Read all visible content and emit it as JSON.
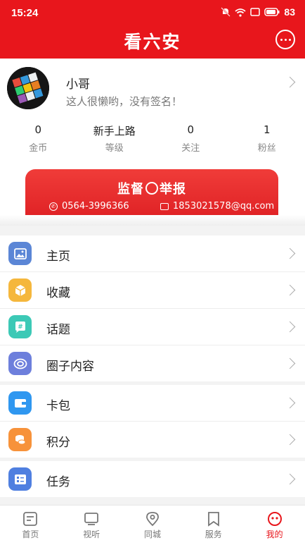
{
  "status_bar": {
    "time": "15:24",
    "battery": "83"
  },
  "header": {
    "title": "看六安"
  },
  "profile": {
    "username": "小哥",
    "signature": "这人很懒哟，没有签名！",
    "stats": [
      {
        "value": "0",
        "label": "金币"
      },
      {
        "value": "新手上路",
        "label": "等级"
      },
      {
        "value": "0",
        "label": "关注"
      },
      {
        "value": "1",
        "label": "粉丝"
      }
    ]
  },
  "report": {
    "title_left": "监督",
    "title_right": "举报",
    "phone": "0564-3996366",
    "email": "1853021578@qq.com"
  },
  "menu_groups": [
    {
      "items": [
        {
          "label": "主页",
          "icon": "image-icon",
          "color": "#5b86d6"
        },
        {
          "label": "收藏",
          "icon": "box-icon",
          "color": "#f5b73c"
        },
        {
          "label": "话题",
          "icon": "topic-icon",
          "color": "#3cc9b6"
        },
        {
          "label": "圈子内容",
          "icon": "circle-icon",
          "color": "#6d7fdc"
        }
      ]
    },
    {
      "items": [
        {
          "label": "卡包",
          "icon": "card-icon",
          "color": "#2f97f0"
        },
        {
          "label": "积分",
          "icon": "coins-icon",
          "color": "#f7923a"
        }
      ]
    },
    {
      "items": [
        {
          "label": "任务",
          "icon": "task-icon",
          "color": "#4f7fe0"
        }
      ]
    }
  ],
  "tabbar": {
    "active_color": "#e8161c",
    "items": [
      {
        "label": "首页",
        "icon": "home-doc-icon"
      },
      {
        "label": "视听",
        "icon": "tv-icon"
      },
      {
        "label": "同城",
        "icon": "location-icon"
      },
      {
        "label": "服务",
        "icon": "bookmark-icon"
      },
      {
        "label": "我的",
        "icon": "user-face-icon",
        "active": true
      }
    ]
  }
}
